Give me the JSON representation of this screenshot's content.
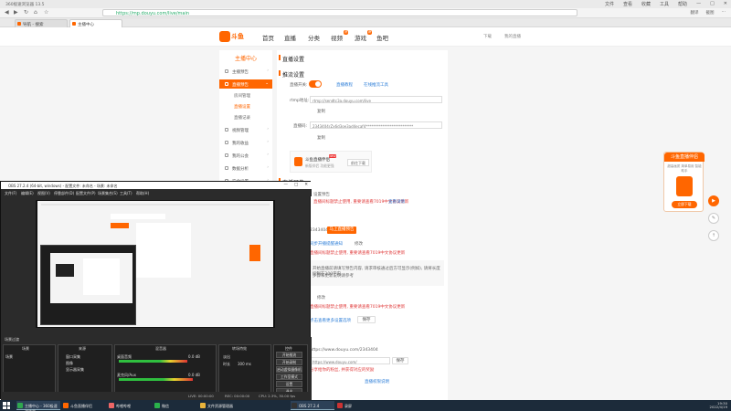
{
  "browser": {
    "window_title": "360极速浏览器 13.5",
    "system_controls": [
      "文件",
      "查看",
      "收藏",
      "工具",
      "帮助"
    ],
    "url": "https://mp.douyu.com/live/main",
    "nav_right": [
      "翻译",
      "截图",
      "⋯"
    ],
    "tabs": [
      {
        "label": "导航 - 搜索"
      },
      {
        "label": "主播中心"
      }
    ]
  },
  "site": {
    "logo": "斗鱼",
    "menu": [
      "首页",
      "直播",
      "分类",
      "视频",
      "游戏",
      "鱼吧"
    ],
    "menu_badge_video": "热",
    "menu_badge_game": "新",
    "header_right": [
      "下载",
      "我的直播"
    ]
  },
  "sidebar": {
    "title": "主播中心",
    "items": [
      {
        "label": "主播预告"
      },
      {
        "label": "直播预告"
      },
      {
        "label": "视频管理"
      },
      {
        "label": "我的收益"
      },
      {
        "label": "我的公会"
      },
      {
        "label": "数据分析"
      },
      {
        "label": "安全设置"
      }
    ],
    "subitems": [
      "房间管理",
      "直播设置",
      "直播记录"
    ]
  },
  "content": {
    "section1_title": "直播设置",
    "subsection1": "推流设置",
    "live_switch_label": "直播开关:",
    "link_tutorial": "直播教程",
    "link_obs": "在线推流工具",
    "rtmp_label": "rtmp地址:",
    "rtmp_value": "rtmp://sendtc3a.douyu.com/live",
    "copy1": "复制",
    "stream_key_label": "直播码:",
    "stream_key_value": "2343404rZx6d3oe3ad4ecaf4**************************",
    "copy2": "复制",
    "assistant_name": "斗鱼直播伴侣",
    "assistant_new": "NEW",
    "assistant_sub": "新版伴侣 功能更强",
    "assistant_download": "前往下载",
    "section2_title": "直播预告",
    "notice_status": "设置预告",
    "warning1": "直播间标题禁止使用, 重要请查看7019中文协议更新",
    "link_view": "查看详情",
    "room_id": "2343404",
    "btn_apply": "马上直播预告",
    "link_tip": "同步开播提醒通知",
    "link_set": "修改",
    "warning2": "直播间标题禁止使用, 重要请查看7019中文协议更新",
    "notice_text1": "开始直播前请填写预告内容, 请求审核通过后方可显示(例如), 请将长度控制在200字内",
    "notice_text2": "步骤和更新说明请参考",
    "label_modify": "修改",
    "warning3": "直播间标题禁止使用, 重要请查看7019中文协议更新",
    "link_more": "点击查看更多设置选项",
    "btn_save": "保存",
    "url_share": "https://www.douyu.com/2343404",
    "input_share": "https://www.douyu.com/",
    "share_hint": "分享给你的粉丝, 并获得对应的奖励",
    "btn_share_save": "保存",
    "link_help": "直播权限说明"
  },
  "float_widget": {
    "title": "斗鱼直播伴侣",
    "subtitle": "超高画质 简单易用 智能助手",
    "button": "立即下载"
  },
  "obs": {
    "title": "OBS 27.2.4 (64-bit, windows) - 配置文件: 未命名 - 场景: 未命名",
    "menu": [
      "文件(F)",
      "编辑(E)",
      "视图(V)",
      "停靠部件(D)",
      "配置文件(P)",
      "场景集合(S)",
      "工具(T)",
      "帮助(H)"
    ],
    "dock_titles": [
      "场景",
      "来源",
      "混音器",
      "转场特效",
      "控件"
    ],
    "scene_name": "场景",
    "sources": [
      "窗口采集",
      "图像",
      "显示器采集"
    ],
    "mixer_tracks": [
      "桌面音频",
      "麦克风/Aux"
    ],
    "mixer_levels": [
      0.72,
      0.78
    ],
    "mixer_db": [
      "0.0 dB",
      "0.0 dB"
    ],
    "transition": "淡出",
    "transition_duration_label": "时长",
    "transition_duration": "300 ms",
    "controls": [
      "开始推流",
      "开始录制",
      "启动虚拟摄像机",
      "工作室模式",
      "设置",
      "退出"
    ],
    "status": [
      "LIVE: 00:00:00",
      "REC: 00:00:00",
      "CPU: 2.3%, 30.00 fps"
    ],
    "preview_label": "场景过渡"
  },
  "taskbar": {
    "apps": [
      {
        "label": "主播中心 - 360极速浏览器",
        "color": "#2fa84f"
      },
      {
        "label": "斗鱼直播伴侣",
        "color": "#f60"
      },
      {
        "label": "哔哩哔哩",
        "color": "#e66"
      },
      {
        "label": "微信",
        "color": "#2ab24b"
      },
      {
        "label": "文件资源管理器",
        "color": "#e9b33b"
      },
      {
        "label": "OBS 27.2.4",
        "color": "#333"
      },
      {
        "label": "录屏",
        "color": "#c33"
      }
    ],
    "time": "19:30",
    "date": "2022/4/19"
  }
}
